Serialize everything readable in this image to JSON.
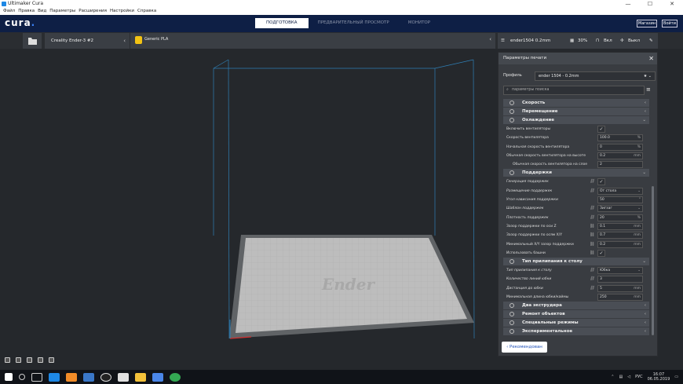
{
  "window": {
    "title": "Ultimaker Cura",
    "min": "—",
    "max": "☐",
    "close": "✕"
  },
  "menu": [
    "Файл",
    "Правка",
    "Вид",
    "Параметры",
    "Расширения",
    "Настройки",
    "Справка"
  ],
  "header": {
    "logo_main": "cura",
    "logo_dot": ".",
    "stages": [
      "ПОДГОТОВКА",
      "ПРЕДВАРИТЕЛЬНЫЙ ПРОСМОТР",
      "МОНИТОР"
    ],
    "marketplace": "Магазин",
    "signin": "Войти"
  },
  "printer": {
    "name": "Creality Ender-3 #2",
    "material": "Generic PLA"
  },
  "quick": {
    "profile": "ender1504 0.2mm",
    "infill": "30%",
    "support": "Вкл",
    "adhesion": "Выкл"
  },
  "panel": {
    "title": "Параметры печати",
    "profile_label": "Профиль",
    "profile_value": "ender 1504 - 0.2mm",
    "search_placeholder": "параметры поиска",
    "recommended": "Рекомендован"
  },
  "settings": {
    "cat_speed": "Скорость",
    "cat_travel": "Перемещение",
    "cat_cooling": "Охлаждение",
    "cool": [
      {
        "label": "Включить вентиляторы",
        "check": "✓"
      },
      {
        "label": "Скорость вентилятора",
        "value": "100.0",
        "unit": "%"
      },
      {
        "label": "Начальная скорость вентилятора",
        "value": "0",
        "unit": "%"
      },
      {
        "label": "Обычная скорость вентилятора на высоте",
        "value": "0.2",
        "unit": "mm"
      },
      {
        "label": "Обычная скорость вентилятора на слое",
        "value": "2",
        "unit": ""
      }
    ],
    "cat_support": "Поддержки",
    "support": [
      {
        "label": "Генерация поддержек",
        "check": "✓"
      },
      {
        "label": "Размещение поддержек",
        "value": "От стола",
        "unit": "⌄"
      },
      {
        "label": "Угол нависания поддержки",
        "value": "50",
        "unit": "°"
      },
      {
        "label": "Шаблон поддержек",
        "value": "Зигзаг",
        "unit": "⌄"
      },
      {
        "label": "Плотность поддержек",
        "value": "20",
        "unit": "%"
      },
      {
        "label": "Зазор поддержки по оси Z",
        "value": "0.1",
        "unit": "mm"
      },
      {
        "label": "Зазор поддержки по осям X/Y",
        "value": "0.7",
        "unit": "mm"
      },
      {
        "label": "Минимальный X/Y зазор поддержки",
        "value": "0.2",
        "unit": "mm"
      },
      {
        "label": "Использовать башни",
        "check": "✓"
      }
    ],
    "cat_adhesion": "Тип прилипания к столу",
    "adhesion": [
      {
        "label": "Тип прилипания к столу",
        "value": "Юбка",
        "unit": "⌄"
      },
      {
        "label": "Количество линий юбки",
        "value": "3",
        "unit": ""
      },
      {
        "label": "Дистанция до юбки",
        "value": "5",
        "unit": "mm"
      },
      {
        "label": "Минимальная длина юбки/каймы",
        "value": "250",
        "unit": "mm"
      }
    ],
    "cat_dual": "Два экструдера",
    "cat_mesh": "Ремонт объектов",
    "cat_special": "Специальные режимы",
    "cat_exp": "Экспериментальное"
  },
  "bed_logo": "Ender",
  "tray": {
    "lang": "РУС",
    "time": "16:07",
    "date": "06.05.2019"
  }
}
